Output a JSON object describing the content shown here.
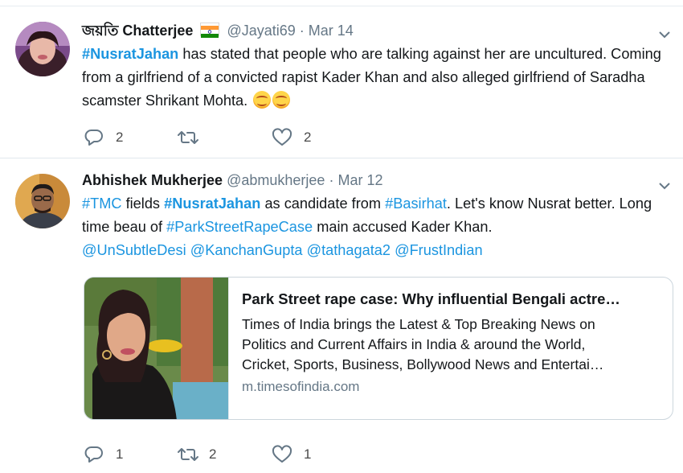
{
  "tweets": [
    {
      "name": "জয়তি Chatterjee",
      "handle": "@Jayati69",
      "separator": "·",
      "date": "Mar 14",
      "flag_icon": "india-flag-emoji",
      "text_parts": {
        "tag1": "#NusratJahan",
        "t1": " has stated that people who are talking against her are uncultured. Coming from a girlfriend of a convicted rapist Kader Khan and also alleged girlfriend of Saradha scamster Shrikant Mohta."
      },
      "emojis": [
        "smiling-face-emoji",
        "smiling-face-emoji"
      ],
      "actions": {
        "reply": "2",
        "retweet": "",
        "like": "2"
      }
    },
    {
      "name": "Abhishek Mukherjee",
      "handle": "@abmukherjee",
      "separator": "·",
      "date": "Mar 12",
      "text_parts": {
        "tag1": "#TMC",
        "t1": " fields ",
        "tag2": "#NusratJahan",
        "t2": " as candidate from ",
        "tag3": "#Basirhat",
        "t3": ". Let's know Nusrat better. Long time beau of ",
        "tag4": "#ParkStreetRapeCase",
        "t4": " main accused Kader Khan.",
        "m1": "@UnSubtleDesi",
        "m2": "@KanchanGupta",
        "m3": "@tathagata2",
        "m4": "@FrustIndian"
      },
      "card": {
        "title": "Park Street rape case: Why influential Bengali actre…",
        "desc_lines": [
          "Times of India brings the Latest & Top Breaking News on",
          "Politics and Current Affairs in India & around the World,",
          "Cricket, Sports, Business, Bollywood News and Entertai…"
        ],
        "domain": "m.timesofindia.com"
      },
      "actions": {
        "reply": "1",
        "retweet": "2",
        "like": "1"
      }
    }
  ],
  "colors": {
    "link": "#1b95e0",
    "muted": "#657786",
    "text": "#14171a",
    "border": "#e1e8ed"
  },
  "icons": [
    "reply-icon",
    "retweet-icon",
    "like-heart-icon",
    "chevron-down-icon"
  ]
}
